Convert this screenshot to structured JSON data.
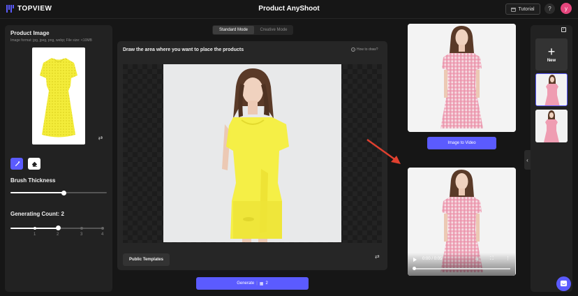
{
  "header": {
    "logo_text": "TOPVIEW",
    "title": "Product AnyShoot",
    "tutorial_label": "Tutorial",
    "help_label": "?",
    "avatar_letter": "y"
  },
  "left_panel": {
    "product_image_title": "Product Image",
    "format_hint": "Image format: jpg, jpeg, png, webp; File size: <10MB",
    "brush_thickness_label": "Brush Thickness",
    "brush_thickness_value": 0.55,
    "generating_count_label": "Generating Count: 2",
    "generating_count_value": 2,
    "count_ticks": [
      "1",
      "2",
      "3",
      "4"
    ]
  },
  "modes": {
    "standard": "Standard Mode",
    "creative": "Creative Mode",
    "active": "standard"
  },
  "canvas": {
    "instruction": "Draw the area where you want to place the products",
    "how_to": "How to draw?",
    "public_templates": "Public Templates"
  },
  "generate": {
    "label": "Generate",
    "credits": "2"
  },
  "results": {
    "image_to_video": "Image to Video",
    "video_time": "0:00 / 0:05"
  },
  "history": {
    "new_label": "New"
  },
  "colors": {
    "accent": "#5b5bff",
    "mask_yellow": "#f5ef3d",
    "arrow": "#e0402f"
  }
}
